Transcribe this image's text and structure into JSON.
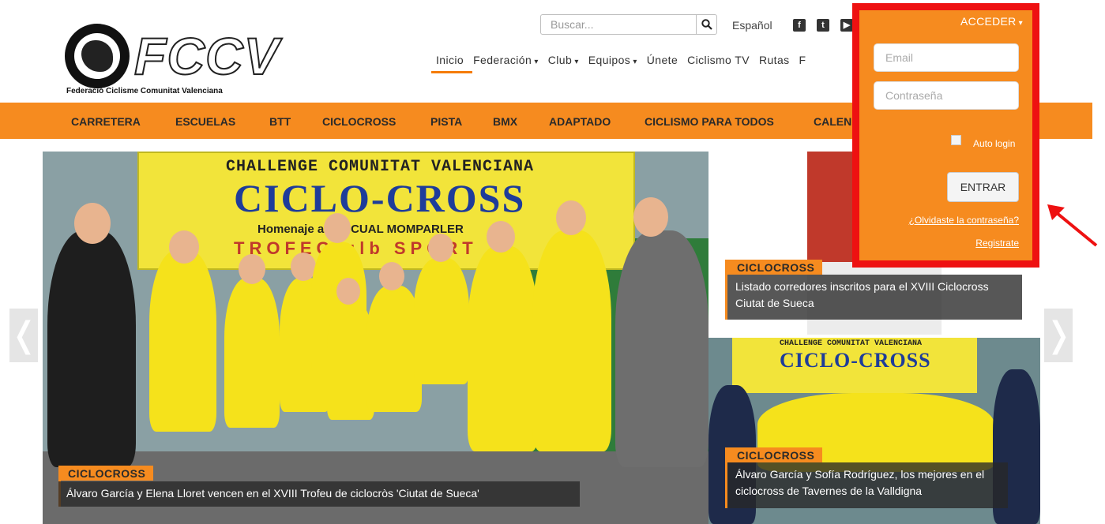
{
  "header": {
    "logo_text": "FCCV",
    "logo_subtitle": "Federació Ciclisme Comunitat Valenciana",
    "search_placeholder": "Buscar...",
    "language": "Español",
    "social_icons": [
      "facebook-icon",
      "twitter-icon",
      "youtube-icon"
    ]
  },
  "topnav": {
    "items": [
      {
        "label": "Inicio",
        "dropdown": false
      },
      {
        "label": "Federación",
        "dropdown": true
      },
      {
        "label": "Club",
        "dropdown": true
      },
      {
        "label": "Equipos",
        "dropdown": true
      },
      {
        "label": "Únete",
        "dropdown": false
      },
      {
        "label": "Ciclismo TV",
        "dropdown": false
      },
      {
        "label": "Rutas",
        "dropdown": false
      },
      {
        "label": "F",
        "dropdown": false
      }
    ]
  },
  "catbar": {
    "items": [
      "CARRETERA",
      "ESCUELAS",
      "BTT",
      "CICLOCROSS",
      "PISTA",
      "BMX",
      "ADAPTADO",
      "CICLISMO PARA TODOS",
      "CALENDA"
    ]
  },
  "slider": {
    "main": {
      "banner_line1": "CHALLENGE COMUNITAT VALENCIANA",
      "banner_line2": "CICLO-CROSS",
      "banner_line3": "Homenaje a PASCUAL MOMPARLER",
      "banner_line4": "TROFEO  ulb  SPORT",
      "category": "CICLOCROSS",
      "caption": "Álvaro García y Elena Lloret vencen en el XVIII Trofeu de ciclocròs 'Ciutat de Sueca'"
    },
    "side_top": {
      "category": "CICLOCROSS",
      "caption": "Listado corredores inscritos para el XVIII Ciclocross Ciutat de Sueca"
    },
    "side_bottom": {
      "banner_line1": "CHALLENGE COMUNITAT VALENCIANA",
      "banner_line2": "CICLO-CROSS",
      "category": "CICLOCROSS",
      "caption": "Álvaro García y Sofía Rodríguez, los mejores en el ciclocross de Tavernes de la Valldigna"
    },
    "prev_glyph": "❬",
    "next_glyph": "❭"
  },
  "login": {
    "toggle_label": "ACCEDER",
    "email_placeholder": "Email",
    "password_placeholder": "Contraseña",
    "autologin_label": "Auto login",
    "submit_label": "ENTRAR",
    "forgot_label": "¿Olvidaste la contraseña?",
    "register_label": "Registrate"
  },
  "colors": {
    "accent": "#f68b1f",
    "highlight_box": "#ee1111"
  }
}
